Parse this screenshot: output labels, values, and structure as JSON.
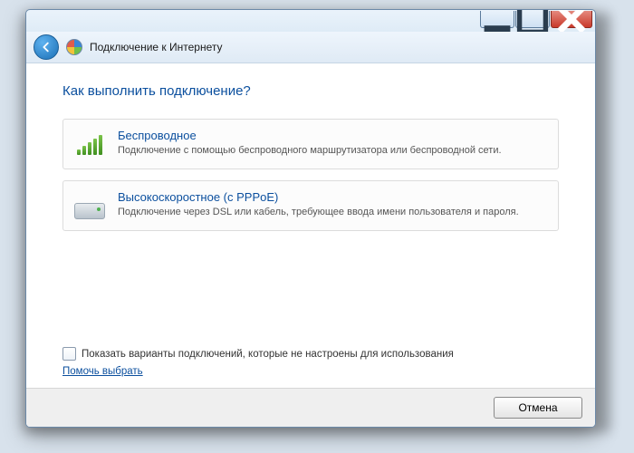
{
  "window": {
    "title": "Подключение к Интернету"
  },
  "heading": "Как выполнить подключение?",
  "options": [
    {
      "title": "Беспроводное",
      "desc": "Подключение с помощью беспроводного маршрутизатора или беспроводной сети."
    },
    {
      "title": "Высокоскоростное (с PPPoE)",
      "desc": "Подключение через DSL или кабель, требующее ввода имени пользователя и пароля."
    }
  ],
  "show_unconfigured_label": "Показать варианты подключений, которые не настроены для использования",
  "help_link": "Помочь выбрать",
  "cancel_label": "Отмена"
}
